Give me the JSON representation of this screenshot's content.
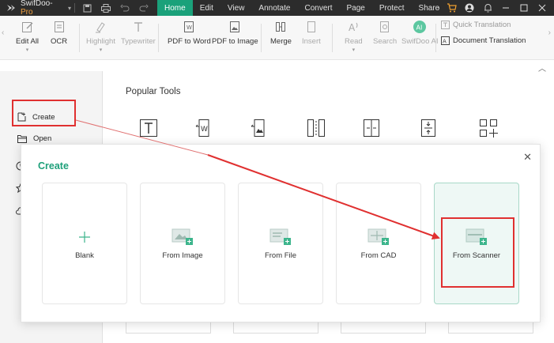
{
  "app": {
    "name": "SwifDoo",
    "edition": "Pro"
  },
  "menu": {
    "items": [
      "Home",
      "Edit",
      "View",
      "Annotate",
      "Convert",
      "Page",
      "Protect",
      "Share"
    ],
    "active": "Home"
  },
  "toolbar": {
    "edit_all": "Edit All",
    "ocr": "OCR",
    "highlight": "Highlight",
    "typewriter": "Typewriter",
    "pdf_to_word": "PDF to Word",
    "pdf_to_image": "PDF to Image",
    "merge": "Merge",
    "insert": "Insert",
    "read": "Read",
    "search": "Search",
    "swifdoo_ai": "SwifDoo AI",
    "ai_badge": "AI",
    "quick_translation": "Quick Translation",
    "document_translation": "Document Translation"
  },
  "sidebar": {
    "create": "Create",
    "open": "Open"
  },
  "main": {
    "popular_tools": "Popular Tools"
  },
  "dialog": {
    "title": "Create",
    "cards": [
      {
        "label": "Blank"
      },
      {
        "label": "From Image"
      },
      {
        "label": "From File"
      },
      {
        "label": "From CAD"
      },
      {
        "label": "From Scanner"
      }
    ],
    "selected": "From Scanner"
  },
  "colors": {
    "accent": "#1aa17a",
    "titlebar": "#2c2c2c",
    "highlight_red": "#e03030"
  }
}
